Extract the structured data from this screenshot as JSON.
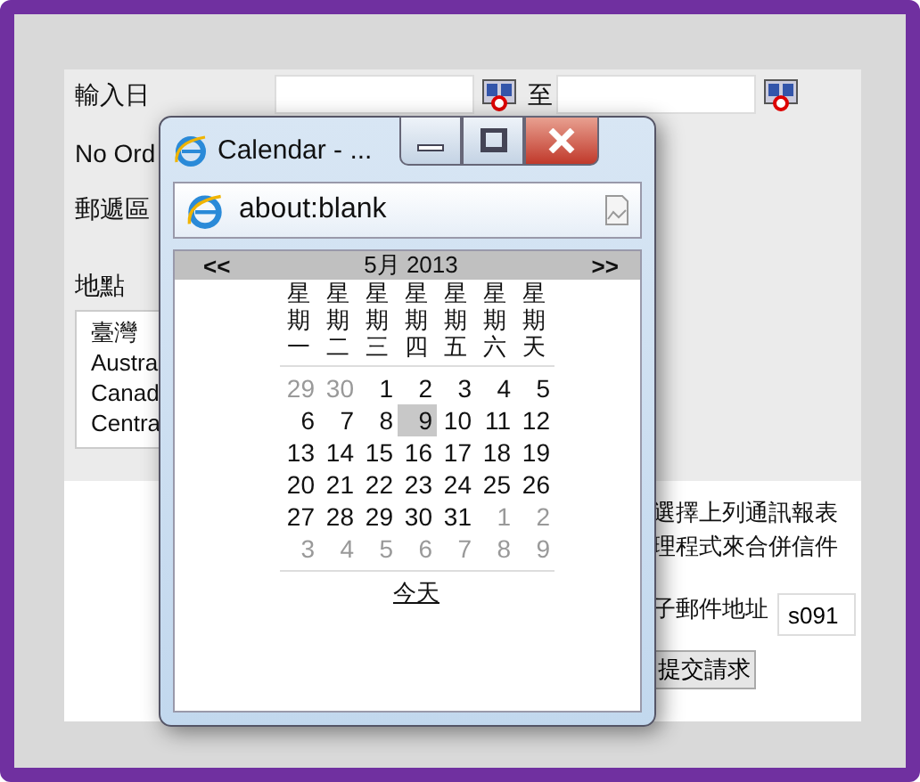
{
  "form": {
    "date_label": "輸入日",
    "date_to_label": "至",
    "order_label": "No Ord",
    "zip_label": "郵遞區",
    "location_label": "地點",
    "locations": [
      "臺灣",
      "Austra",
      "Canad",
      "Centra"
    ],
    "notice_lines": [
      "選擇上列通訊報表",
      "理程式來合併信件"
    ],
    "email_label": "子郵件地址",
    "email_value": "s091",
    "submit": "提交請求"
  },
  "popup": {
    "title": "Calendar - ...",
    "address": "about:blank",
    "calendar": {
      "prev": "<<",
      "month": "5月 2013",
      "next": ">>",
      "weekdays": [
        "星期一",
        "星期二",
        "星期三",
        "星期四",
        "星期五",
        "星期六",
        "星期天"
      ],
      "weeks": [
        [
          {
            "day": "29",
            "other": true,
            "selected": false
          },
          {
            "day": "30",
            "other": true,
            "selected": false
          },
          {
            "day": "1",
            "other": false,
            "selected": false
          },
          {
            "day": "2",
            "other": false,
            "selected": false
          },
          {
            "day": "3",
            "other": false,
            "selected": false
          },
          {
            "day": "4",
            "other": false,
            "selected": false
          },
          {
            "day": "5",
            "other": false,
            "selected": false
          }
        ],
        [
          {
            "day": "6",
            "other": false,
            "selected": false
          },
          {
            "day": "7",
            "other": false,
            "selected": false
          },
          {
            "day": "8",
            "other": false,
            "selected": false
          },
          {
            "day": "9",
            "other": false,
            "selected": true
          },
          {
            "day": "10",
            "other": false,
            "selected": false
          },
          {
            "day": "11",
            "other": false,
            "selected": false
          },
          {
            "day": "12",
            "other": false,
            "selected": false
          }
        ],
        [
          {
            "day": "13",
            "other": false,
            "selected": false
          },
          {
            "day": "14",
            "other": false,
            "selected": false
          },
          {
            "day": "15",
            "other": false,
            "selected": false
          },
          {
            "day": "16",
            "other": false,
            "selected": false
          },
          {
            "day": "17",
            "other": false,
            "selected": false
          },
          {
            "day": "18",
            "other": false,
            "selected": false
          },
          {
            "day": "19",
            "other": false,
            "selected": false
          }
        ],
        [
          {
            "day": "20",
            "other": false,
            "selected": false
          },
          {
            "day": "21",
            "other": false,
            "selected": false
          },
          {
            "day": "22",
            "other": false,
            "selected": false
          },
          {
            "day": "23",
            "other": false,
            "selected": false
          },
          {
            "day": "24",
            "other": false,
            "selected": false
          },
          {
            "day": "25",
            "other": false,
            "selected": false
          },
          {
            "day": "26",
            "other": false,
            "selected": false
          }
        ],
        [
          {
            "day": "27",
            "other": false,
            "selected": false
          },
          {
            "day": "28",
            "other": false,
            "selected": false
          },
          {
            "day": "29",
            "other": false,
            "selected": false
          },
          {
            "day": "30",
            "other": false,
            "selected": false
          },
          {
            "day": "31",
            "other": false,
            "selected": false
          },
          {
            "day": "1",
            "other": true,
            "selected": false
          },
          {
            "day": "2",
            "other": true,
            "selected": false
          }
        ],
        [
          {
            "day": "3",
            "other": true,
            "selected": false
          },
          {
            "day": "4",
            "other": true,
            "selected": false
          },
          {
            "day": "5",
            "other": true,
            "selected": false
          },
          {
            "day": "6",
            "other": true,
            "selected": false
          },
          {
            "day": "7",
            "other": true,
            "selected": false
          },
          {
            "day": "8",
            "other": true,
            "selected": false
          },
          {
            "day": "9",
            "other": true,
            "selected": false
          }
        ]
      ],
      "today": "今天"
    }
  }
}
